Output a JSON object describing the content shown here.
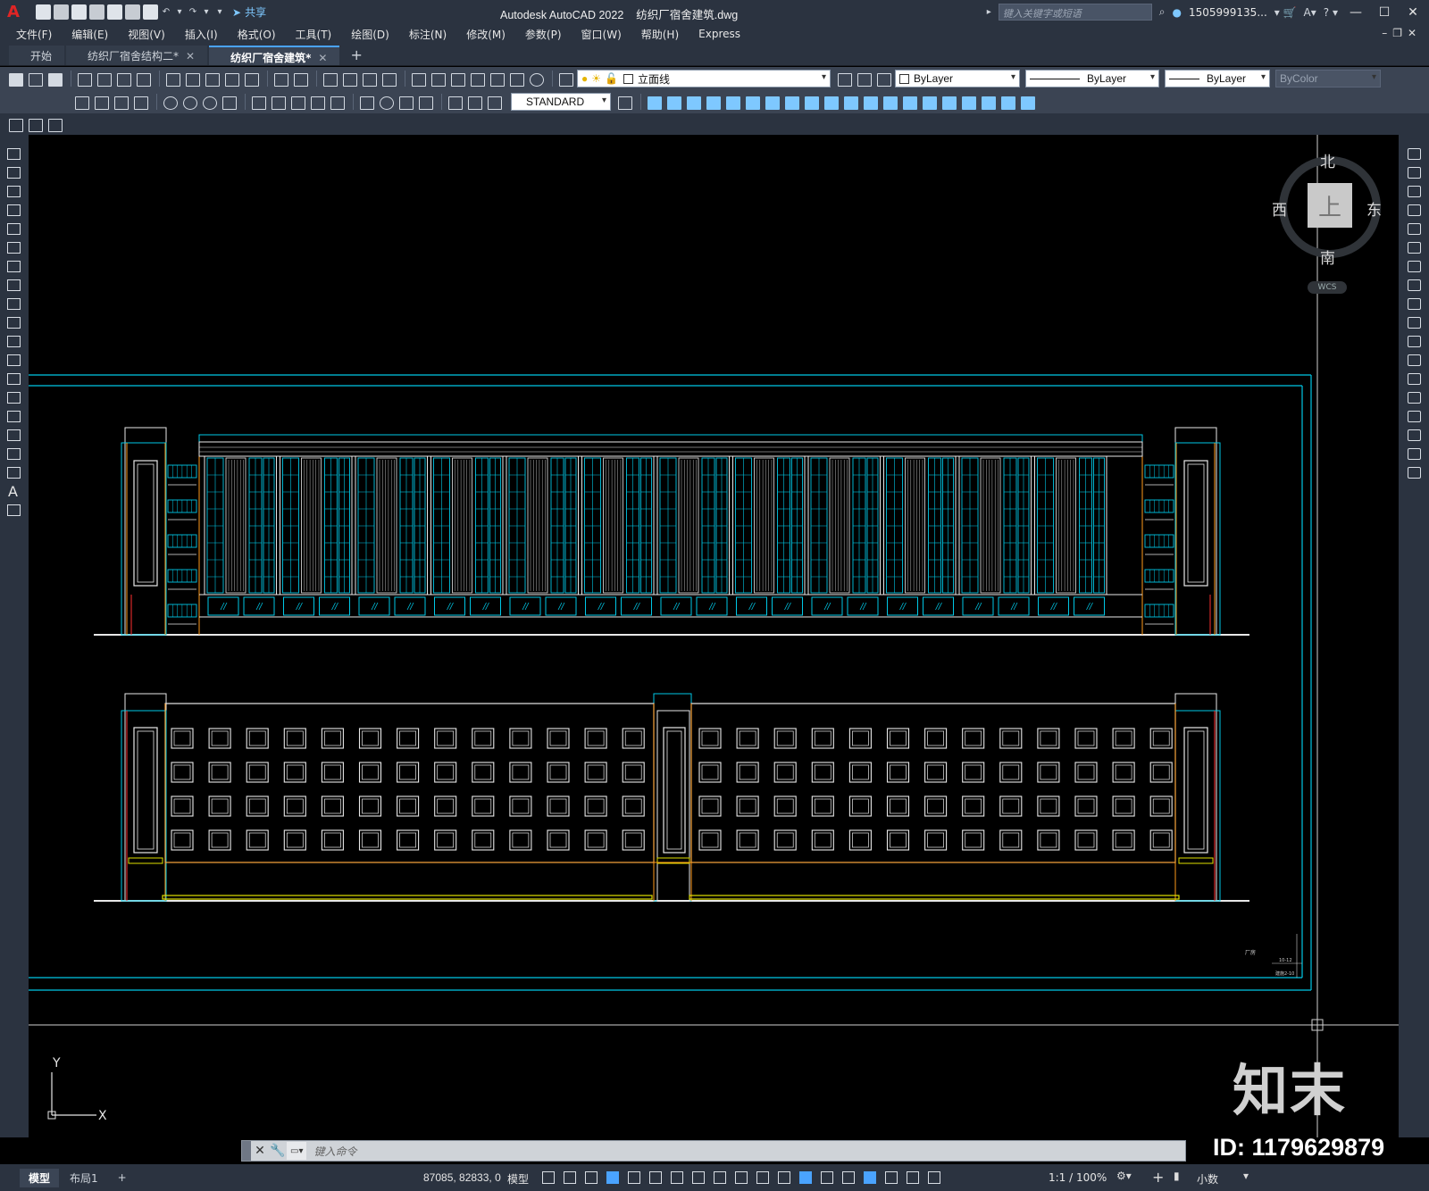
{
  "window": {
    "app_title": "Autodesk AutoCAD 2022",
    "file_title": "纺织厂宿舍建筑.dwg",
    "share_label": "共享",
    "search_placeholder": "键入关键字或短语",
    "user": "1505999135..."
  },
  "menu": [
    "文件(F)",
    "编辑(E)",
    "视图(V)",
    "插入(I)",
    "格式(O)",
    "工具(T)",
    "绘图(D)",
    "标注(N)",
    "修改(M)",
    "参数(P)",
    "窗口(W)",
    "帮助(H)",
    "Express"
  ],
  "file_tabs": [
    {
      "label": "开始",
      "active": false,
      "closable": false
    },
    {
      "label": "纺织厂宿舍结构二*",
      "active": false,
      "closable": true
    },
    {
      "label": "纺织厂宿舍建筑*",
      "active": true,
      "closable": true
    }
  ],
  "toolbar": {
    "layer": "立面线",
    "color": "ByLayer",
    "linetype": "ByLayer",
    "lineweight": "ByLayer",
    "plotstyle": "ByColor",
    "dimstyle": "STANDARD"
  },
  "viewcube": {
    "north": "北",
    "south": "南",
    "east": "东",
    "west": "西",
    "face": "上",
    "wcs": "WCS"
  },
  "ucs": {
    "x": "X",
    "y": "Y"
  },
  "drawing_notes": {
    "label1": "厂房",
    "label2": "10-12",
    "label3": "建施2-10"
  },
  "watermark": {
    "logo": "知末",
    "id": "ID: 1179629879"
  },
  "command": {
    "placeholder": "键入命令"
  },
  "status": {
    "layout_tabs": [
      {
        "label": "模型",
        "active": true
      },
      {
        "label": "布局1",
        "active": false
      }
    ],
    "coords": "87085, 82833, 0",
    "model": "模型",
    "scale": "1:1 / 100%",
    "units": "小数"
  },
  "colors": {
    "cyan": "#00c8e6",
    "white": "#e8e8e8",
    "orange": "#ff9a1a",
    "red": "#ff3030",
    "yellow": "#e0e000"
  }
}
